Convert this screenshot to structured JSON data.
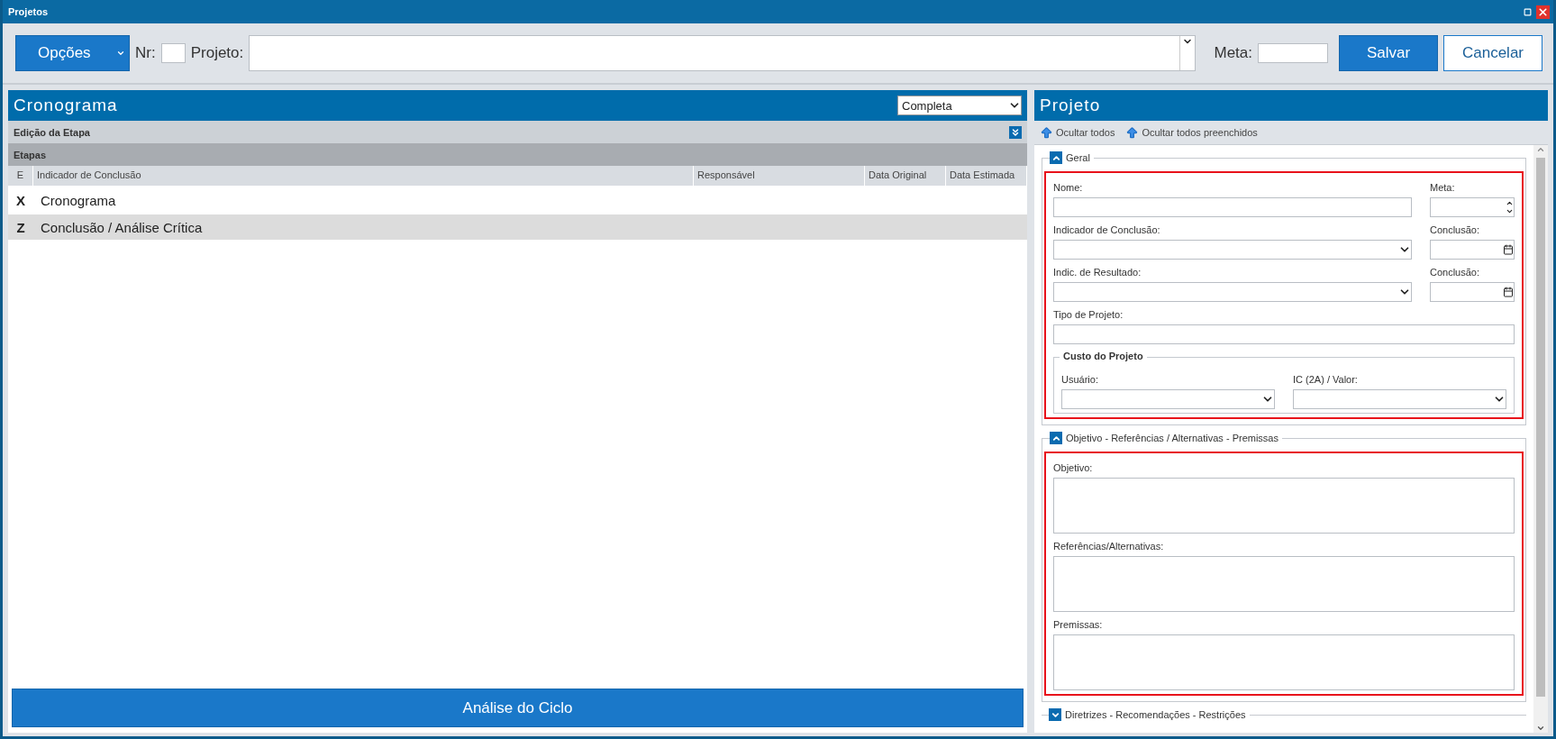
{
  "window": {
    "title": "Projetos"
  },
  "toolbar": {
    "options": "Opções",
    "nr_label": "Nr:",
    "project_label": "Projeto:",
    "meta_label": "Meta:",
    "save": "Salvar",
    "cancel": "Cancelar"
  },
  "cronograma": {
    "title": "Cronograma",
    "filter": "Completa",
    "edit_section": "Edição da Etapa",
    "group": "Etapas",
    "columns": [
      "E",
      "Indicador de Conclusão",
      "Responsável",
      "Data Original",
      "Data Estimada"
    ],
    "rows": [
      {
        "e": "X",
        "indicator": "Cronograma",
        "selected": false
      },
      {
        "e": "Z",
        "indicator": "Conclusão / Análise Crítica",
        "selected": true
      }
    ],
    "footer_button": "Análise do Ciclo"
  },
  "projeto": {
    "title": "Projeto",
    "actions": [
      "Ocultar todos",
      "Ocultar todos preenchidos"
    ],
    "sections": [
      {
        "title": "Geral",
        "expanded": true,
        "highlighted": true,
        "rows": [
          [
            {
              "label": "Nome:",
              "kind": "text"
            },
            {
              "label": "Meta:",
              "kind": "spin"
            }
          ],
          [
            {
              "label": "Indicador de Conclusão:",
              "kind": "select"
            },
            {
              "label": "Conclusão:",
              "kind": "date"
            }
          ],
          [
            {
              "label": "Indic. de Resultado:",
              "kind": "select"
            },
            {
              "label": "Conclusão:",
              "kind": "date"
            }
          ],
          [
            {
              "label": "Tipo de Projeto:",
              "kind": "text"
            }
          ]
        ],
        "group": {
          "title": "Custo do Projeto",
          "fields": [
            {
              "label": "Usuário:",
              "kind": "select"
            },
            {
              "label": "IC (2A) / Valor:",
              "kind": "select"
            }
          ]
        }
      },
      {
        "title": "Objetivo - Referências / Alternativas - Premissas",
        "expanded": true,
        "highlighted": true,
        "rows": [
          [
            {
              "label": "Objetivo:",
              "kind": "textarea"
            }
          ],
          [
            {
              "label": "Referências/Alternativas:",
              "kind": "textarea"
            }
          ],
          [
            {
              "label": "Premissas:",
              "kind": "textarea"
            }
          ]
        ]
      },
      {
        "title": "Diretrizes - Recomendações - Restrições",
        "expanded": false
      }
    ]
  }
}
